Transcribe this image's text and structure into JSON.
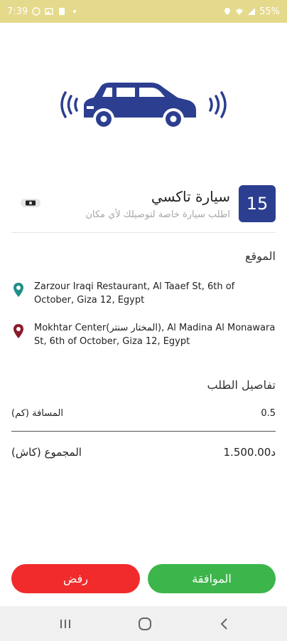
{
  "status_bar": {
    "time": "7:39",
    "battery": "55%",
    "left_icons": [
      "whatsapp-icon",
      "gallery-icon",
      "app-icon",
      "dot-icon"
    ],
    "right_icons": [
      "location-icon",
      "wifi-icon",
      "signal-icon"
    ]
  },
  "service": {
    "badge_number": "15",
    "title": "سيارة تاكسي",
    "subtitle": "اطلب سيارة خاصة لتوصيلك لأي مكان"
  },
  "location": {
    "heading": "الموقع",
    "pickup": "Zarzour Iraqi Restaurant, Al Taaef St, 6th of October, Giza 12, Egypt",
    "dropoff": "Mokhtar Center(المختار سنتر), Al Madina Al Monawara St, 6th of October, Giza 12, Egypt"
  },
  "order_details": {
    "heading": "تفاصيل الطلب",
    "distance_label": "المسافة (كم)",
    "distance_value": "0.5",
    "total_label": "المجموع (كاش)",
    "total_value": "د1.500.00"
  },
  "actions": {
    "accept_label": "الموافقة",
    "reject_label": "رفض"
  },
  "colors": {
    "status_bar": "#e5d98c",
    "brand_blue": "#2c3e8f",
    "accept": "#3cb54a",
    "reject": "#f12b2b",
    "pickup_pin": "#1f8f87",
    "dropoff_pin": "#8b1a2b"
  }
}
